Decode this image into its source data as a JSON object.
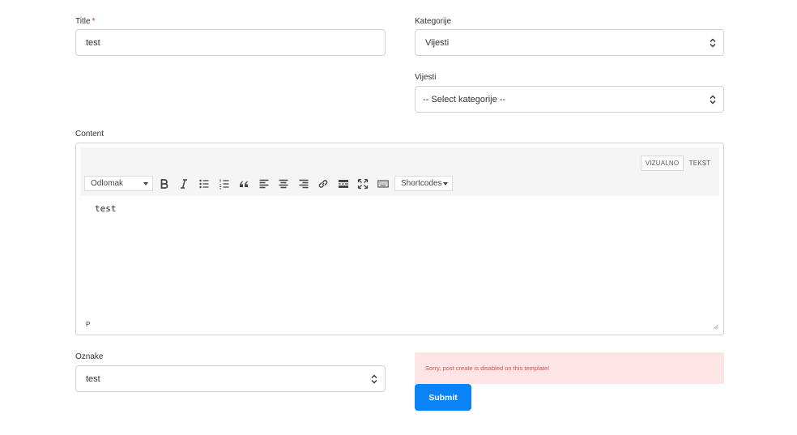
{
  "form": {
    "title": {
      "label": "Title",
      "required_mark": "*",
      "value": "test"
    },
    "kategorije": {
      "label": "Kategorije",
      "selected": "Vijesti"
    },
    "vijesti": {
      "label": "Vijesti",
      "selected": "-- Select kategorije --"
    },
    "content": {
      "label": "Content"
    },
    "oznake": {
      "label": "Oznake",
      "selected": "test"
    }
  },
  "editor": {
    "tabs": {
      "visual": "VIZUALNO",
      "text": "TEKST"
    },
    "format_select": "Odlomak",
    "shortcodes_select": "Shortcodes",
    "toolbar_icons": [
      "bold-icon",
      "italic-icon",
      "bullet-list-icon",
      "numbered-list-icon",
      "blockquote-icon",
      "align-left-icon",
      "align-center-icon",
      "align-right-icon",
      "link-icon",
      "read-more-icon",
      "fullscreen-icon",
      "keyboard-icon"
    ],
    "body_text": "test",
    "path": "P"
  },
  "alert": {
    "message": "Sorry, post create is disabled on this template!"
  },
  "submit": {
    "label": "Submit"
  },
  "colors": {
    "accent": "#0b82f5",
    "alert_bg": "#fde4e5",
    "alert_text": "#d9534f",
    "required": "#e0242e"
  }
}
